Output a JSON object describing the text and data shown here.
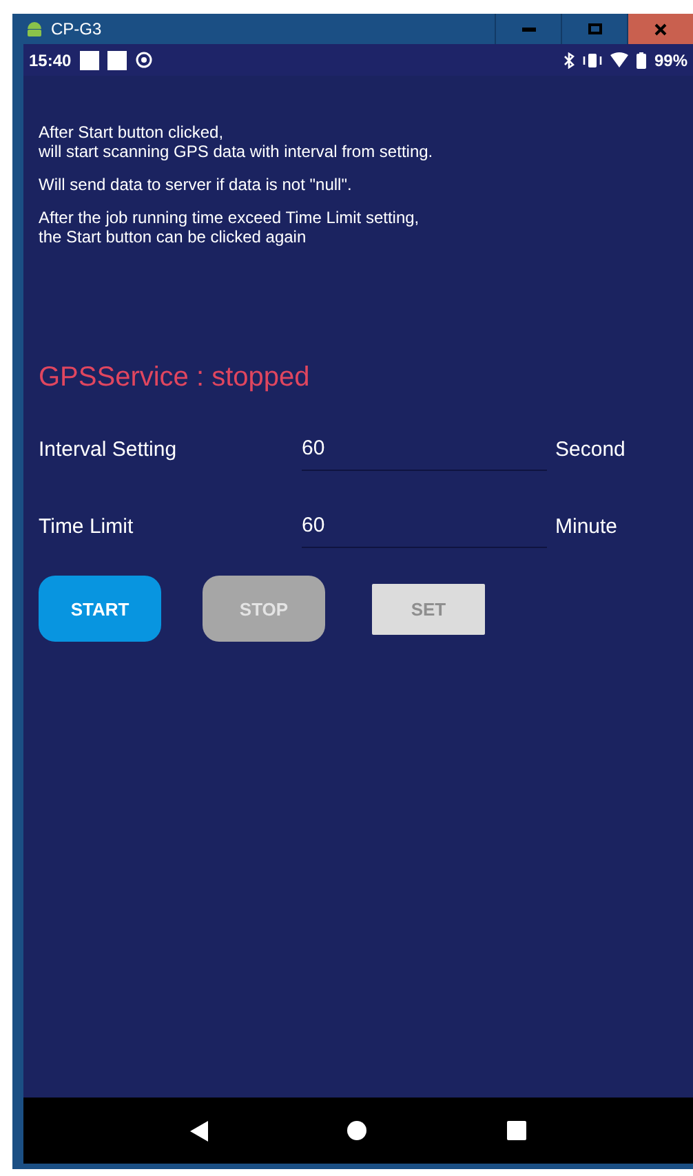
{
  "window": {
    "title": "CP-G3"
  },
  "status_bar": {
    "time": "15:40",
    "battery": "99%"
  },
  "instructions": [
    "After Start button clicked,\nwill start scanning GPS data with interval from setting.",
    "Will send data to server if data is not \"null\".",
    "After the job running time exceed Time Limit setting,\nthe Start button can be clicked again"
  ],
  "service_status": "GPSService : stopped",
  "settings": [
    {
      "label": "Interval Setting",
      "value": "60",
      "unit": "Second"
    },
    {
      "label": "Time Limit",
      "value": "60",
      "unit": "Minute"
    }
  ],
  "buttons": [
    {
      "label": "START",
      "kind": "rounded",
      "disabled": false
    },
    {
      "label": "STOP",
      "kind": "rounded",
      "disabled": true
    },
    {
      "label": "SET",
      "kind": "flat",
      "disabled": true
    }
  ]
}
